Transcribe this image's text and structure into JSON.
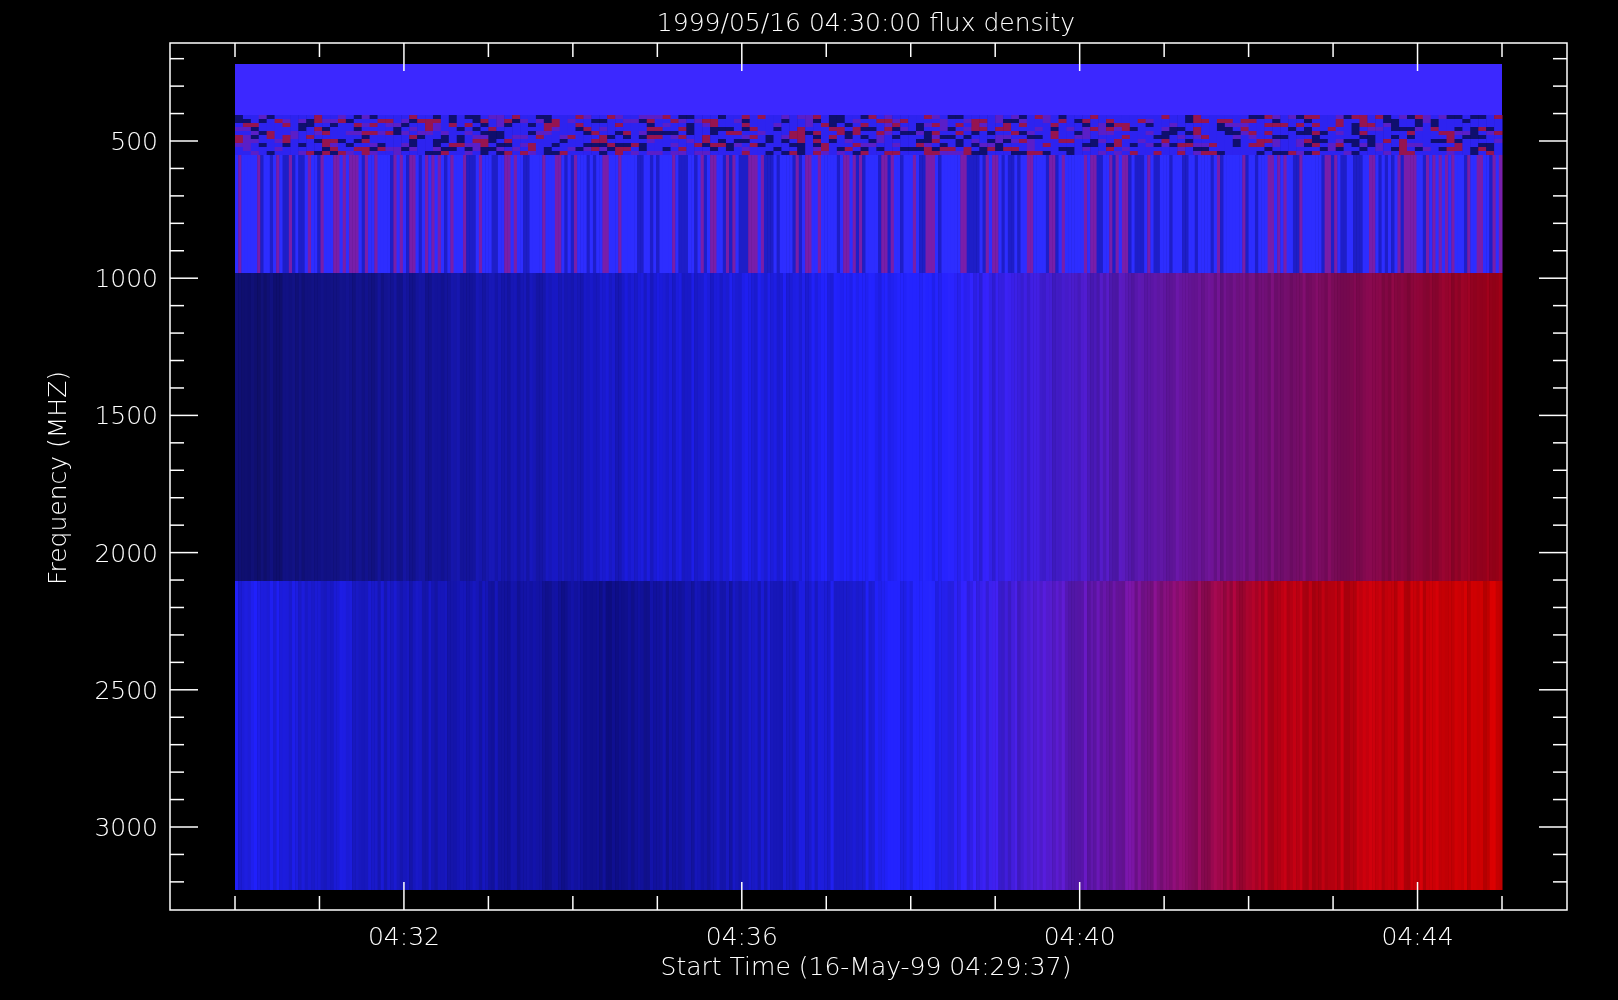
{
  "plot": {
    "title": "1999/05/16 04:30:00 flux density",
    "y_axis_title": "Frequency (MHZ)",
    "x_axis_title": "Start Time (16-May-99 04:29:37)",
    "y_tick_labels": [
      "500",
      "1000",
      "1500",
      "2000",
      "2500",
      "3000"
    ],
    "x_tick_labels": [
      "04:32",
      "04:36",
      "04:40",
      "04:44"
    ]
  }
}
